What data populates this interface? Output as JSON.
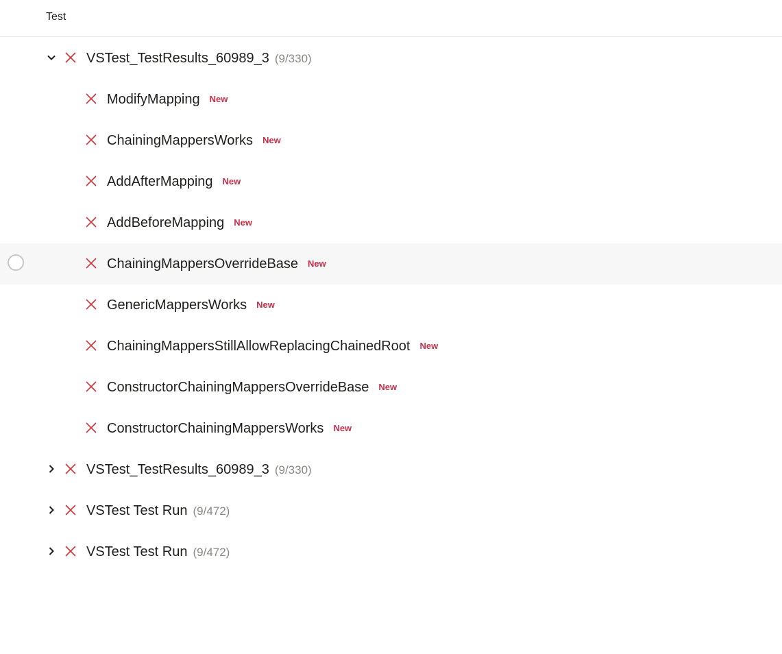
{
  "header": {
    "title": "Test"
  },
  "groups": [
    {
      "name": "VSTest_TestResults_60989_3",
      "count": "(9/330)",
      "expanded": true,
      "children": [
        {
          "name": "ModifyMapping",
          "badge": "New"
        },
        {
          "name": "ChainingMappersWorks",
          "badge": "New"
        },
        {
          "name": "AddAfterMapping",
          "badge": "New"
        },
        {
          "name": "AddBeforeMapping",
          "badge": "New"
        },
        {
          "name": "ChainingMappersOverrideBase",
          "badge": "New",
          "selected": true
        },
        {
          "name": "GenericMappersWorks",
          "badge": "New"
        },
        {
          "name": "ChainingMappersStillAllowReplacingChainedRoot",
          "badge": "New"
        },
        {
          "name": "ConstructorChainingMappersOverrideBase",
          "badge": "New"
        },
        {
          "name": "ConstructorChainingMappersWorks",
          "badge": "New"
        }
      ]
    },
    {
      "name": "VSTest_TestResults_60989_3",
      "count": "(9/330)",
      "expanded": false
    },
    {
      "name": "VSTest Test Run",
      "count": "(9/472)",
      "expanded": false
    },
    {
      "name": "VSTest Test Run",
      "count": "(9/472)",
      "expanded": false
    }
  ],
  "colors": {
    "fail": "#d13438",
    "badge": "#c4314b",
    "count": "#8a8886",
    "selected_row": "#f7f7f7"
  },
  "icons": {
    "expanded": "chevron-down-icon",
    "collapsed": "chevron-right-icon",
    "failed": "failed-x-icon",
    "select": "select-circle-icon"
  }
}
